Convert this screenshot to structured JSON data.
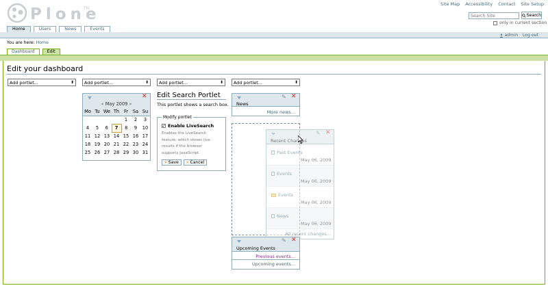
{
  "header": {
    "logo_text": "Plone",
    "trademark": "TM",
    "site_actions": [
      "Site Map",
      "Accessibility",
      "Contact",
      "Site Setup"
    ],
    "search": {
      "placeholder": "Search Site",
      "button_label": "Search",
      "only_current": "only in current section"
    }
  },
  "nav": {
    "tabs": [
      "Home",
      "Users",
      "News",
      "Events"
    ],
    "active": "Home"
  },
  "personal": {
    "user": "admin",
    "logout": "Log out"
  },
  "breadcrumb": {
    "prefix": "You are here:",
    "home": "Home"
  },
  "edit_tabs": [
    "Dashboard",
    "Edit"
  ],
  "page": {
    "title": "Edit your dashboard"
  },
  "add_portlet_label": "Add portlet...",
  "calendar": {
    "prev": "«",
    "month": "May 2009",
    "next": "»",
    "days": [
      "Mo",
      "Tu",
      "We",
      "Th",
      "Fr",
      "Sa",
      "Su"
    ],
    "weeks": [
      [
        "",
        "",
        "",
        "",
        "1",
        "2",
        "3"
      ],
      [
        "4",
        "5",
        "6",
        "7",
        "8",
        "9",
        "10"
      ],
      [
        "11",
        "12",
        "13",
        "14",
        "15",
        "16",
        "17"
      ],
      [
        "18",
        "19",
        "20",
        "21",
        "22",
        "23",
        "24"
      ],
      [
        "25",
        "26",
        "27",
        "28",
        "29",
        "30",
        "31"
      ]
    ],
    "today": "7"
  },
  "search_portlet": {
    "title": "Edit Search Portlet",
    "description": "This portlet shows a search box.",
    "legend": "Modify portlet",
    "checkbox_label": "Enable LiveSearch",
    "help_lines": [
      "Enables the LiveSearch",
      "feature, which shows live",
      "results if the browser",
      "supports JavaScript."
    ],
    "save": "Save",
    "cancel": "Cancel"
  },
  "news_portlet": {
    "title": "News",
    "more": "More news..."
  },
  "recent_changes": {
    "title": "Recent Changes",
    "items": [
      {
        "label": "Past Events",
        "date": "May 06, 2009",
        "icon": "document-icon"
      },
      {
        "label": "Events",
        "date": "May 06, 2009",
        "icon": "document-icon"
      },
      {
        "label": "Events",
        "date": "May 06, 2009",
        "icon": "folder-icon"
      },
      {
        "label": "News",
        "date": "May 06, 2009",
        "icon": "document-icon"
      }
    ],
    "all": "All recent changes..."
  },
  "upcoming_events": {
    "title": "Upcoming Events",
    "previous": "Previous events...",
    "upcoming": "Upcoming events..."
  },
  "colors": {
    "accent": "#74ae0b",
    "nav_border": "#8cacbb",
    "link": "#436976",
    "delete": "#d9261c"
  }
}
